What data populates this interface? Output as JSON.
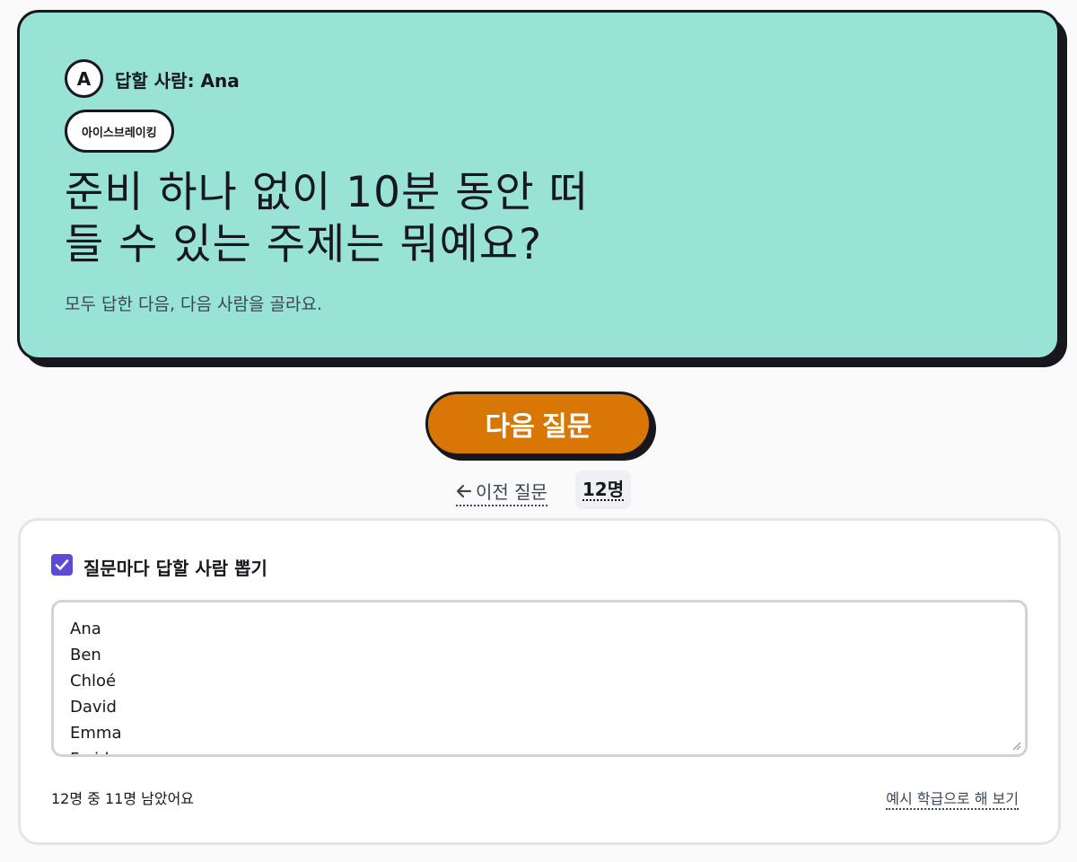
{
  "question_card": {
    "avatar_initial": "A",
    "responder": "답할 사람: Ana",
    "category": "아이스브레이킹",
    "question_line1": "준비 하나 없이 10분 동안 떠",
    "question_line2": "들 수 있는 주제는 뭐예요?",
    "hint": "모두 답한 다음, 다음 사람을 골라요.",
    "background_color": "#98e2d6"
  },
  "controls": {
    "next_label": "다음 질문",
    "next_color": "#d97706",
    "prev_label": "이전 질문",
    "prev_icon": "arrow-left-icon",
    "participant_count": "12명"
  },
  "picker": {
    "checkbox_label": "질문마다 답할 사람 뽑기",
    "checkbox_checked": true,
    "checkbox_color": "#5b4bd6",
    "names": [
      "Ana",
      "Ben",
      "Chloé",
      "David",
      "Emma",
      "Farid"
    ],
    "remaining_text": "12명 중 11명 남았어요",
    "example_link": "예시 학급으로 해 보기"
  }
}
